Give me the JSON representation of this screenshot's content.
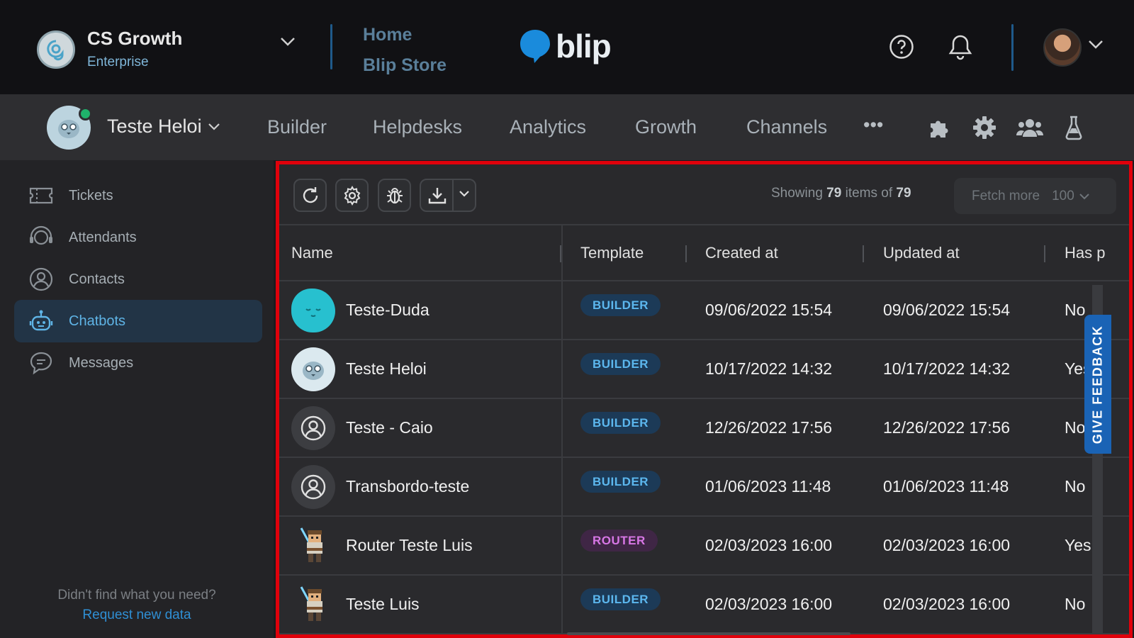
{
  "header": {
    "org_name": "CS Growth",
    "org_plan": "Enterprise",
    "quick_links": [
      "Home",
      "Blip Store"
    ],
    "brand": "blip",
    "icons": [
      "help-icon",
      "notification-bell-icon"
    ]
  },
  "subnav": {
    "bot_name": "Teste Heloi",
    "items": [
      "Builder",
      "Helpdesks",
      "Analytics",
      "Growth",
      "Channels"
    ],
    "more": "•••",
    "icons": [
      "extensions-icon",
      "settings-icon",
      "team-icon",
      "lab-flask-icon"
    ]
  },
  "sidebar": {
    "items": [
      {
        "label": "Tickets",
        "icon": "ticket-icon",
        "active": false
      },
      {
        "label": "Attendants",
        "icon": "headset-icon",
        "active": false
      },
      {
        "label": "Contacts",
        "icon": "contact-icon",
        "active": false
      },
      {
        "label": "Chatbots",
        "icon": "robot-icon",
        "active": true
      },
      {
        "label": "Messages",
        "icon": "message-icon",
        "active": false
      }
    ],
    "help_question": "Didn't find what you need?",
    "help_link": "Request new data"
  },
  "toolbar": {
    "showing_prefix": "Showing",
    "showing_count": "79",
    "showing_mid": "items of",
    "showing_total": "79",
    "fetch_label": "Fetch more",
    "fetch_size": "100"
  },
  "table": {
    "columns": [
      "Name",
      "Template",
      "Created at",
      "Updated at",
      "Has p"
    ],
    "rows": [
      {
        "name": "Teste-Duda",
        "template": "BUILDER",
        "created": "09/06/2022 15:54",
        "updated": "09/06/2022 15:54",
        "has": "No"
      },
      {
        "name": "Teste Heloi",
        "template": "BUILDER",
        "created": "10/17/2022 14:32",
        "updated": "10/17/2022 14:32",
        "has": "Yes"
      },
      {
        "name": "Teste - Caio",
        "template": "BUILDER",
        "created": "12/26/2022 17:56",
        "updated": "12/26/2022 17:56",
        "has": "No"
      },
      {
        "name": "Transbordo-teste",
        "template": "BUILDER",
        "created": "01/06/2023 11:48",
        "updated": "01/06/2023 11:48",
        "has": "No"
      },
      {
        "name": "Router Teste Luis",
        "template": "ROUTER",
        "created": "02/03/2023 16:00",
        "updated": "02/03/2023 16:00",
        "has": "Yes"
      },
      {
        "name": "Teste Luis",
        "template": "BUILDER",
        "created": "02/03/2023 16:00",
        "updated": "02/03/2023 16:00",
        "has": "No"
      }
    ]
  },
  "feedback_label": "GIVE FEEDBACK",
  "colors": {
    "accent": "#2f8fd4",
    "highlight_frame": "#e0000b",
    "online": "#1fb26b"
  }
}
